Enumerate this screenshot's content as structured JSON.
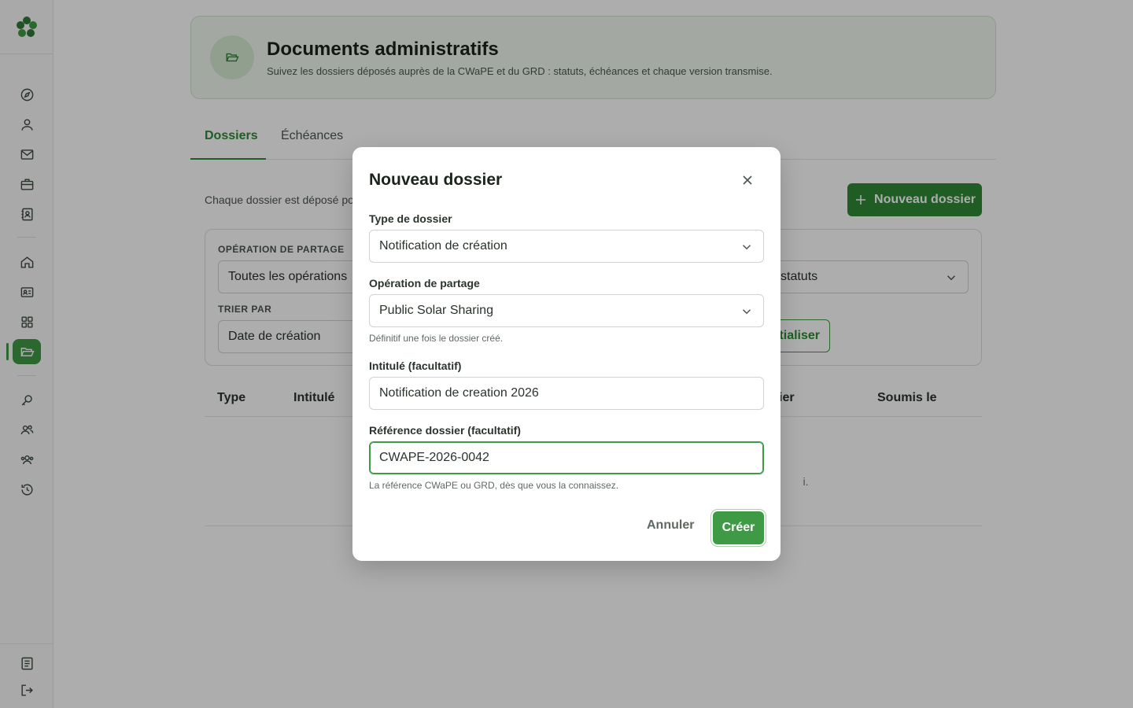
{
  "colors": {
    "accent": "#3f9a45",
    "accent_dark": "#2f8a36",
    "header_bg": "#f1f8f0"
  },
  "sidebar": {
    "logo": "clover-logo",
    "items": [
      {
        "icon": "compass-icon"
      },
      {
        "icon": "user-icon"
      },
      {
        "icon": "mail-icon"
      },
      {
        "icon": "briefcase-icon"
      },
      {
        "icon": "contact-book-icon"
      },
      {
        "icon": "home-icon"
      },
      {
        "icon": "id-card-icon"
      },
      {
        "icon": "grid-icon"
      },
      {
        "icon": "folder-open-icon",
        "active": true
      },
      {
        "icon": "key-search-icon"
      },
      {
        "icon": "users-icon"
      },
      {
        "icon": "users-group-icon"
      },
      {
        "icon": "history-icon"
      },
      {
        "icon": "document-icon"
      },
      {
        "icon": "logout-icon"
      }
    ]
  },
  "header": {
    "title": "Documents administratifs",
    "subtitle": "Suivez les dossiers déposés auprès de la CWaPE et du GRD : statuts, échéances et chaque version transmise."
  },
  "tabs": [
    {
      "label": "Dossiers",
      "active": true
    },
    {
      "label": "Échéances",
      "active": false
    }
  ],
  "intro_text": "Chaque dossier est déposé po",
  "new_button_label": "Nouveau dossier",
  "filters": {
    "operation_label": "OPÉRATION DE PARTAGE",
    "operation_value": "Toutes les opérations",
    "status_value": "statuts",
    "sort_label": "TRIER PAR",
    "sort_value": "Date de création",
    "reset_label": "itialiser"
  },
  "table": {
    "headers": [
      "Type",
      "Intitulé",
      "ier",
      "Soumis le"
    ],
    "empty_text_fragment": "i."
  },
  "modal": {
    "title": "Nouveau dossier",
    "type_label": "Type de dossier",
    "type_value": "Notification de création",
    "operation_label": "Opération de partage",
    "operation_value": "Public Solar Sharing",
    "operation_help": "Définitif une fois le dossier créé.",
    "intitule_label": "Intitulé (facultatif)",
    "intitule_value": "Notification de creation 2026",
    "reference_label": "Référence dossier (facultatif)",
    "reference_value": "CWAPE-2026-0042",
    "reference_help": "La référence CWaPE ou GRD, dès que vous la connaissez.",
    "cancel_label": "Annuler",
    "create_label": "Créer"
  }
}
